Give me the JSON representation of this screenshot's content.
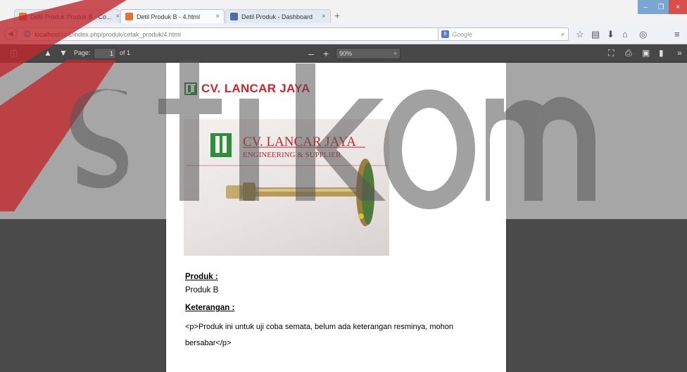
{
  "browser": {
    "tabs": [
      {
        "label": "Detil Produk Produk B - Co...",
        "active": false,
        "close": "×"
      },
      {
        "label": "Detil Produk B - 4.html",
        "active": true,
        "close": "×"
      },
      {
        "label": "Detil Produk - Dashboard",
        "active": false,
        "close": "×"
      }
    ],
    "new_tab": "+",
    "url_host": "localhost",
    "url_path": "/cp1/index.php/produk/cetak_produk/4.html",
    "search_placeholder": "Google",
    "window_controls": {
      "minimize": "–",
      "maximize": "❐",
      "close": "×"
    }
  },
  "pdf_toolbar": {
    "page_label": "Page:",
    "page_value": "1",
    "page_count": "of 1",
    "zoom_value": "90%",
    "zoom_out": "–",
    "zoom_in": "+"
  },
  "document": {
    "brand_name": "CV. LANCAR JAYA",
    "photo_banner_title": "CV. LANCAR JAYA",
    "photo_banner_subtitle": "ENGINEERING & SUPPLIER",
    "produk_label": "Produk :",
    "produk_value": "Produk B",
    "keterangan_label": "Keterangan :",
    "keterangan_value": "<p>Produk ini untuk uji coba semata, belum ada keterangan resminya, mohon bersabar</p>"
  },
  "colors": {
    "brand_red": "#d2232a",
    "brand_green": "#1e8a2a",
    "viewer_bg": "#4b4b4b",
    "toolbar_bg": "#474747",
    "watermark_red": "#c0282d"
  },
  "icons": [
    "back-icon",
    "globe-icon",
    "reload-icon",
    "search-icon",
    "star-icon",
    "library-icon",
    "download-icon",
    "home-icon",
    "menu-icon",
    "sidebar-toggle-icon",
    "prev-page-icon",
    "next-page-icon",
    "fullscreen-icon",
    "print-icon",
    "save-icon",
    "bookmark-icon",
    "more-tools-icon"
  ]
}
